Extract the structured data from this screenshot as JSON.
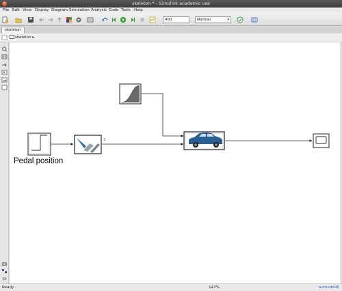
{
  "window": {
    "title": "skeleton * - Simulink academic use"
  },
  "menu": [
    "File",
    "Edit",
    "View",
    "Display",
    "Diagram",
    "Simulation",
    "Analysis",
    "Code",
    "Tools",
    "Help"
  ],
  "toolbar": {
    "stop_time": "400",
    "sim_mode": "Normal"
  },
  "tabs": [
    "skeleton"
  ],
  "address": {
    "model": "skeleton"
  },
  "diagram": {
    "pedal_label": "Pedal position",
    "port_label": "2"
  },
  "status": {
    "left": "Ready",
    "zoom": "147%",
    "solver": "autoode45"
  },
  "colors": {
    "canvas": "#ffffff",
    "car": "#2a5f93",
    "lines": "#222222"
  }
}
